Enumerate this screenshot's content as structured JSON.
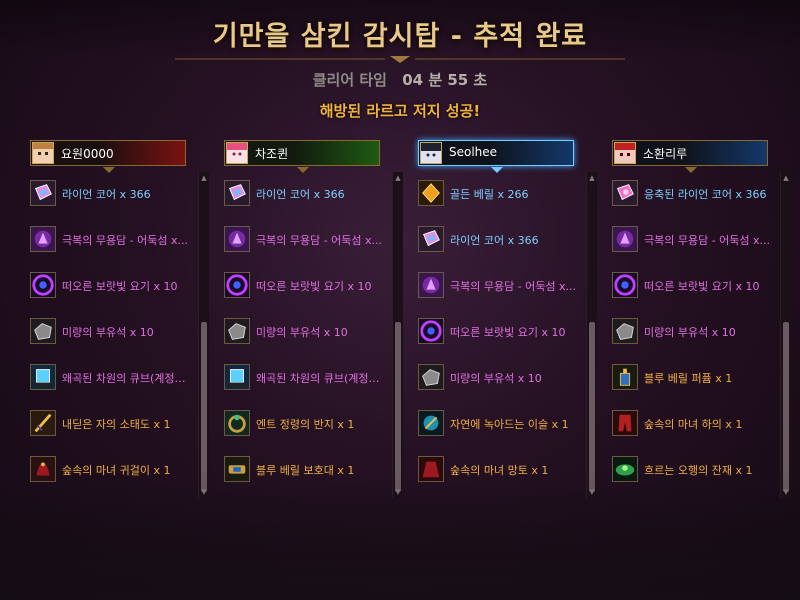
{
  "header": {
    "title": "기만을 삼킨 감시탑 - 추적 완료",
    "clear_label": "클리어 타임",
    "clear_value": "04 분 55 초",
    "success": "해방된 라르고 저지 성공!"
  },
  "colors": {
    "title": "#e8c98a",
    "success": "#f0b43a",
    "name_light_blue": "#7fd0ff",
    "name_pink": "#e070e0",
    "name_orange": "#f0b040"
  },
  "players": [
    {
      "name": "요원0000",
      "bar": "red",
      "items": [
        {
          "name": "라이언 코어 x 366",
          "color": "#7fd0ff",
          "icon": "lion-core-icon"
        },
        {
          "name": "극복의 무용담 - 어둑섬 x...",
          "color": "#e070e0",
          "icon": "heroic-tale-icon"
        },
        {
          "name": "떠오른 보랏빛 요기 x 10",
          "color": "#e070e0",
          "icon": "purple-aura-icon"
        },
        {
          "name": "미량의 부유석 x 10",
          "color": "#e070e0",
          "icon": "floating-stone-icon"
        },
        {
          "name": "왜곡된 차원의 큐브(계정귀...",
          "color": "#e070e0",
          "icon": "distorted-cube-icon"
        },
        {
          "name": "내딛은 자의 소태도 x 1",
          "color": "#f0b040",
          "icon": "blade-icon"
        },
        {
          "name": "숲속의 마녀 귀걸이 x 1",
          "color": "#f0b040",
          "icon": "earring-icon"
        }
      ]
    },
    {
      "name": "차조퀸",
      "bar": "green",
      "items": [
        {
          "name": "라이언 코어 x 366",
          "color": "#7fd0ff",
          "icon": "lion-core-icon"
        },
        {
          "name": "극복의 무용담 - 어둑섬 x...",
          "color": "#e070e0",
          "icon": "heroic-tale-icon"
        },
        {
          "name": "떠오른 보랏빛 요기 x 10",
          "color": "#e070e0",
          "icon": "purple-aura-icon"
        },
        {
          "name": "미량의 부유석 x 10",
          "color": "#e070e0",
          "icon": "floating-stone-icon"
        },
        {
          "name": "왜곡된 차원의 큐브(계정귀...",
          "color": "#e070e0",
          "icon": "distorted-cube-icon"
        },
        {
          "name": "엔트 정령의 반지 x 1",
          "color": "#f0b040",
          "icon": "ring-icon"
        },
        {
          "name": "블루 베릴 보호대 x 1",
          "color": "#f0b040",
          "icon": "bracer-icon"
        }
      ]
    },
    {
      "name": "Seolhee",
      "bar": "blue",
      "active": true,
      "items": [
        {
          "name": "골든 베릴 x 266",
          "color": "#7fd0ff",
          "icon": "golden-beryl-icon"
        },
        {
          "name": "라이언 코어 x 366",
          "color": "#7fd0ff",
          "icon": "lion-core-icon"
        },
        {
          "name": "극복의 무용담 - 어둑섬 x...",
          "color": "#e070e0",
          "icon": "heroic-tale-icon"
        },
        {
          "name": "떠오른 보랏빛 요기 x 10",
          "color": "#e070e0",
          "icon": "purple-aura-icon"
        },
        {
          "name": "미량의 부유석 x 10",
          "color": "#e070e0",
          "icon": "floating-stone-icon"
        },
        {
          "name": "자연에 녹아드는 이슬 x 1",
          "color": "#f0b040",
          "icon": "dew-icon"
        },
        {
          "name": "숲속의 마녀 망토 x 1",
          "color": "#f0b040",
          "icon": "cloak-icon"
        }
      ]
    },
    {
      "name": "소환리루",
      "bar": "blue",
      "items": [
        {
          "name": "응축된 라이언 코어 x 366",
          "color": "#7fd0ff",
          "icon": "condensed-core-icon"
        },
        {
          "name": "극복의 무용담 - 어둑섬 x...",
          "color": "#e070e0",
          "icon": "heroic-tale-icon"
        },
        {
          "name": "떠오른 보랏빛 요기 x 10",
          "color": "#e070e0",
          "icon": "purple-aura-icon"
        },
        {
          "name": "미량의 부유석 x 10",
          "color": "#e070e0",
          "icon": "floating-stone-icon"
        },
        {
          "name": "블루 베릴 퍼퓸 x 1",
          "color": "#f0b040",
          "icon": "perfume-icon"
        },
        {
          "name": "숲속의 마녀 하의 x 1",
          "color": "#f0b040",
          "icon": "pants-icon"
        },
        {
          "name": "흐르는 오행의 잔재 x 1",
          "color": "#f0b040",
          "icon": "five-elements-icon"
        }
      ]
    }
  ]
}
